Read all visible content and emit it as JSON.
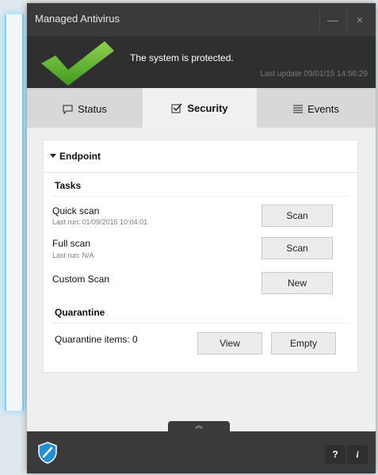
{
  "window": {
    "title": "Managed Antivirus",
    "minimize_glyph": "—",
    "close_glyph": "×"
  },
  "banner": {
    "status": "The system is protected.",
    "last_update": "Last update 09/01/15 14:56:29",
    "check_color": "#5fb82e"
  },
  "tabs": [
    {
      "label": "Status",
      "icon": "chat-bubble-icon",
      "active": false
    },
    {
      "label": "Security",
      "icon": "checkbox-icon",
      "active": true
    },
    {
      "label": "Events",
      "icon": "list-icon",
      "active": false
    }
  ],
  "endpoint": {
    "label": "Endpoint",
    "tasks_title": "Tasks",
    "tasks": [
      {
        "name": "Quick scan",
        "sub": "Last run: 01/09/2015 10:04:01",
        "button": "Scan"
      },
      {
        "name": "Full scan",
        "sub": "Last run: N/A",
        "button": "Scan"
      },
      {
        "name": "Custom Scan",
        "sub": "",
        "button": "New"
      }
    ],
    "quarantine_title": "Quarantine",
    "quarantine_items": "Quarantine items: 0",
    "view_label": "View",
    "empty_label": "Empty"
  },
  "footer": {
    "help_label": "?",
    "info_label": "i",
    "shield_color": "#1f8fd6",
    "grip_glyph": "︽"
  }
}
